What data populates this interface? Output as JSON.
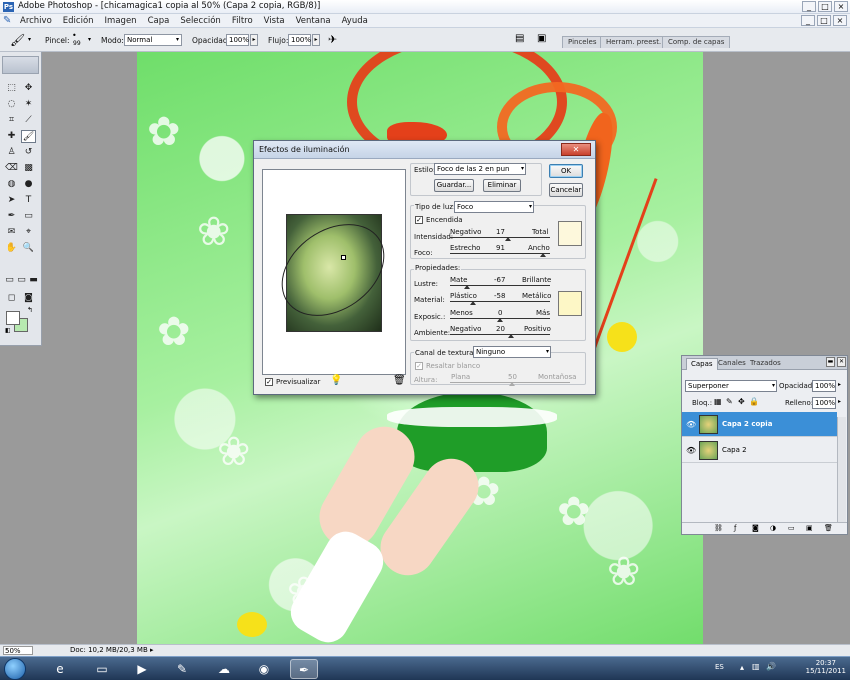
{
  "window": {
    "title": "Adobe Photoshop - [chicamagica1 copia al 50% (Capa 2 copia, RGB/8)]",
    "buttons": [
      "_",
      "□",
      "×"
    ]
  },
  "menubar": {
    "items": [
      "Archivo",
      "Edición",
      "Imagen",
      "Capa",
      "Selección",
      "Filtro",
      "Vista",
      "Ventana",
      "Ayuda"
    ]
  },
  "options": {
    "brush_label": "Pincel:",
    "brush_size": "99",
    "mode_label": "Modo:",
    "mode_value": "Normal",
    "opacity_label": "Opacidad:",
    "opacity_value": "100%",
    "flow_label": "Flujo:",
    "flow_value": "100%",
    "wells": [
      "Pinceles",
      "Herram. preest.",
      "Comp. de capas"
    ]
  },
  "dialog": {
    "title": "Efectos de iluminación",
    "style_label": "Estilo:",
    "style_value": "Foco de las 2 en pun",
    "save_button": "Guardar...",
    "delete_button": "Eliminar",
    "ok_button": "OK",
    "cancel_button": "Cancelar",
    "light_type_label": "Tipo de luz:",
    "light_type_value": "Foco",
    "on_label": "Encendida",
    "intensity_label": "Intensidad:",
    "intensity_left": "Negativo",
    "intensity_value": "17",
    "intensity_right": "Total",
    "focus_label": "Foco:",
    "focus_left": "Estrecho",
    "focus_value": "91",
    "focus_right": "Ancho",
    "properties_label": "Propiedades:",
    "gloss_label": "Lustre:",
    "gloss_left": "Mate",
    "gloss_value": "-67",
    "gloss_right": "Brillante",
    "material_label": "Material:",
    "material_left": "Plástico",
    "material_value": "-58",
    "material_right": "Metálico",
    "exposure_label": "Exposic.:",
    "exposure_left": "Menos",
    "exposure_value": "0",
    "exposure_right": "Más",
    "ambience_label": "Ambiente:",
    "ambience_left": "Negativo",
    "ambience_value": "20",
    "ambience_right": "Positivo",
    "texture_label": "Canal de textura:",
    "texture_value": "Ninguno",
    "white_high_label": "Resaltar blanco",
    "height_label": "Altura:",
    "height_left": "Plana",
    "height_value": "50",
    "height_right": "Montañosa",
    "preview_label": "Previsualizar"
  },
  "layers": {
    "tabs": [
      "Capas",
      "Canales",
      "Trazados"
    ],
    "blend_mode": "Superponer",
    "opacity_label": "Opacidad:",
    "opacity_value": "100%",
    "lock_label": "Bloq.:",
    "fill_label": "Relleno:",
    "fill_value": "100%",
    "rows": [
      {
        "name": "Capa 2 copia",
        "selected": true
      },
      {
        "name": "Capa 2",
        "selected": false
      }
    ]
  },
  "status": {
    "zoom": "50%",
    "doc": "Doc: 10,2 MB/20,3 MB"
  },
  "taskbar": {
    "lang": "ES",
    "time": "20:37",
    "date": "15/11/2011"
  },
  "colors": {
    "selection_blue": "#3b8fd7",
    "canvas_green": "#6fde6a",
    "light_swatch": "#fdf8dc"
  }
}
